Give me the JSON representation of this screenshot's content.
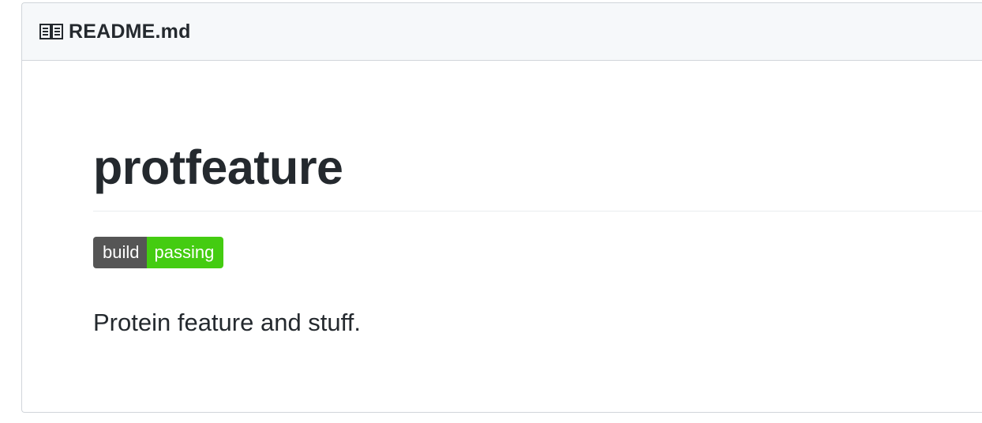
{
  "header": {
    "icon": "book-icon",
    "title": "README.md"
  },
  "readme": {
    "title": "protfeature",
    "badge": {
      "label": "build",
      "status": "passing",
      "label_color": "#555555",
      "status_color": "#44cc11"
    },
    "description": "Protein feature and stuff."
  }
}
